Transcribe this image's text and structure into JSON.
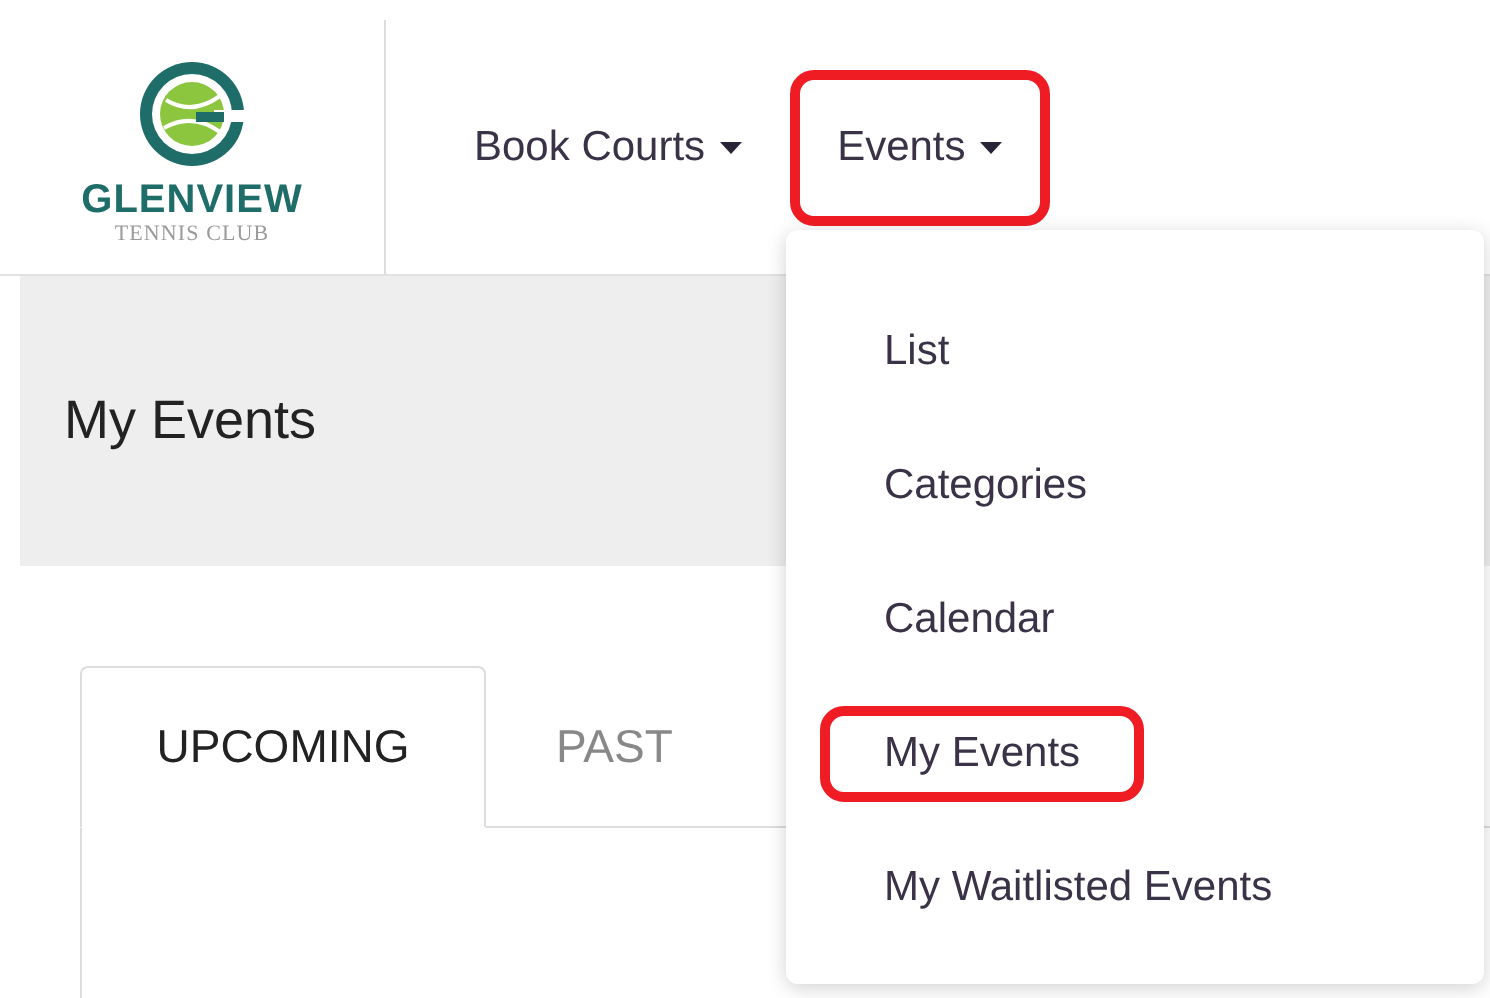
{
  "logo": {
    "name": "GLENVIEW",
    "subtitle": "TENNIS CLUB"
  },
  "nav": [
    {
      "label": "Book Courts",
      "highlighted": false
    },
    {
      "label": "Events",
      "highlighted": true
    }
  ],
  "dropdown": {
    "items": [
      {
        "label": "List",
        "highlighted": false
      },
      {
        "label": "Categories",
        "highlighted": false
      },
      {
        "label": "Calendar",
        "highlighted": false
      },
      {
        "label": "My Events",
        "highlighted": true
      },
      {
        "label": "My Waitlisted Events",
        "highlighted": false
      }
    ]
  },
  "page_title": "My Events",
  "tabs": [
    {
      "label": "UPCOMING",
      "selected": true
    },
    {
      "label": "PAST",
      "selected": false
    }
  ]
}
